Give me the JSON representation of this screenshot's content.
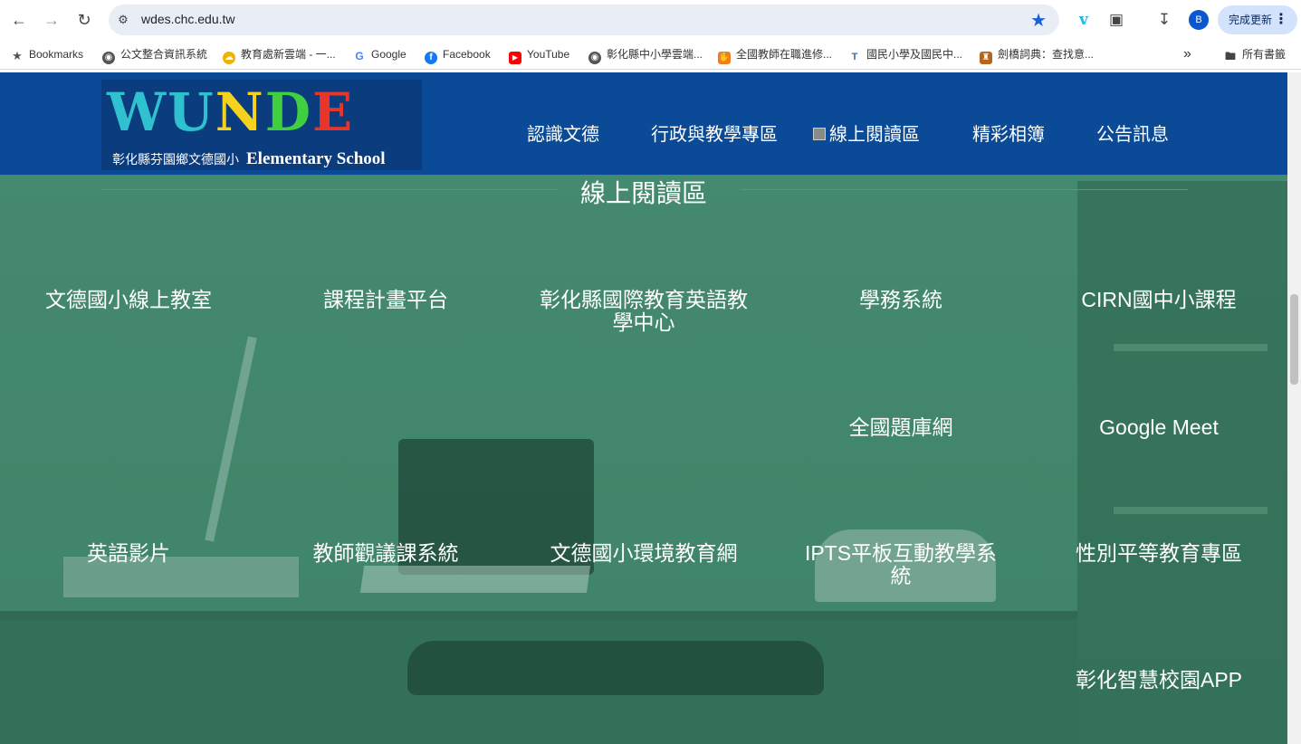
{
  "browser": {
    "url": "wdes.chc.edu.tw",
    "update_label": "完成更新",
    "avatar_letter": "B",
    "bookmarks": [
      {
        "label": "Bookmarks",
        "icon": "star-icon",
        "color": "#555555"
      },
      {
        "label": "公文整合資訊系統",
        "icon": "globe-icon",
        "color": "#555555"
      },
      {
        "label": "教育處新雲端 - 一...",
        "icon": "cloud-icon",
        "color": "#f2b200"
      },
      {
        "label": "Google",
        "icon": "google-icon",
        "color": "#4285f4"
      },
      {
        "label": "Facebook",
        "icon": "facebook-icon",
        "color": "#1877f2"
      },
      {
        "label": "YouTube",
        "icon": "youtube-icon",
        "color": "#ff0000"
      },
      {
        "label": "彰化縣中小學雲端...",
        "icon": "globe-icon",
        "color": "#555555"
      },
      {
        "label": "全國教師在職進修...",
        "icon": "hand-icon",
        "color": "#f47c20"
      },
      {
        "label": "國民小學及國民中...",
        "icon": "te-icon",
        "color": "#2f6fb6"
      },
      {
        "label": "劍橋詞典：查找意...",
        "icon": "crest-icon",
        "color": "#b5651d"
      }
    ],
    "all_bookmarks": "所有書籤"
  },
  "site": {
    "logo_letters": "WUNDE",
    "logo_caption": "彰化縣芬園鄉文德國小",
    "logo_caption_en": "Elementary School",
    "menu": [
      {
        "label": "認識文德"
      },
      {
        "label": "行政與教學專區"
      },
      {
        "label": "線上閱讀區"
      },
      {
        "label": "精彩相簿"
      },
      {
        "label": "公告訊息"
      }
    ],
    "section_title": "線上閱讀區",
    "links_row1": [
      "文德國小線上教室",
      "課程計畫平台",
      "彰化縣國際教育英語教學中心",
      "學務系統",
      "CIRN國中小課程"
    ],
    "links_row2": [
      "全國題庫網",
      "Google Meet"
    ],
    "links_row3": [
      "英語影片",
      "教師觀議課系統",
      "文德國小環境教育網",
      "IPTS平板互動教學系統",
      "性別平等教育專區"
    ],
    "links_row4": [
      "彰化智慧校園APP"
    ]
  },
  "colors": {
    "header_bg": "#0b4a96",
    "page_green": "#3f8468",
    "accent_blue": "#1a5fd6"
  }
}
